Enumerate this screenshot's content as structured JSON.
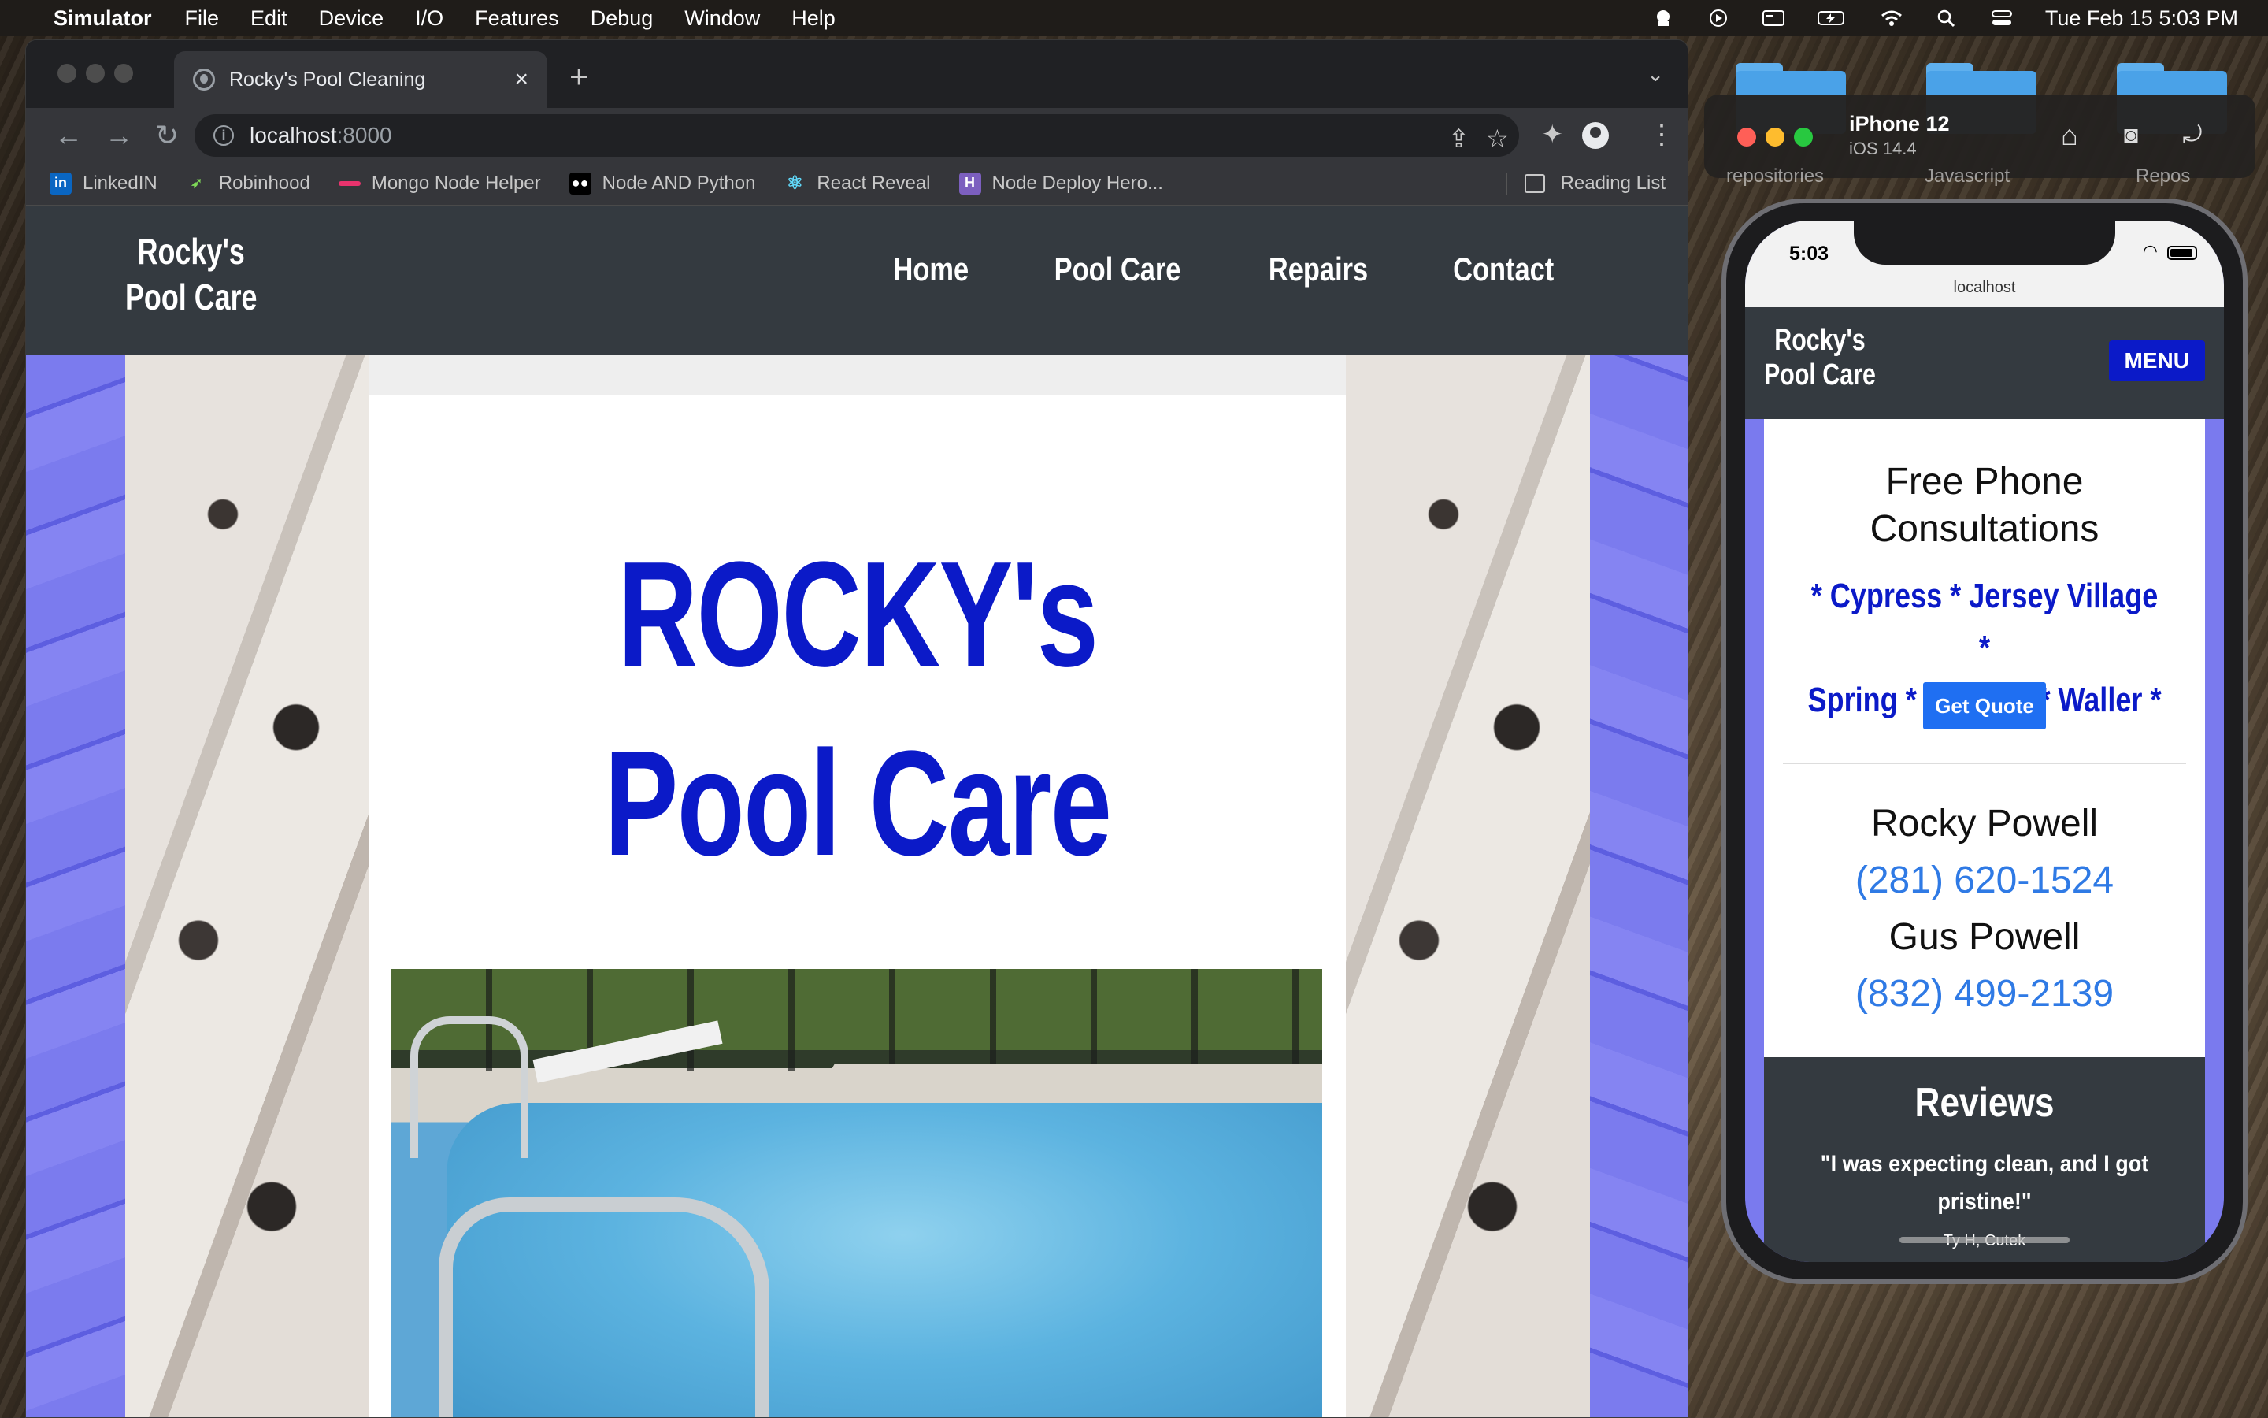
{
  "menubar": {
    "app_name": "Simulator",
    "items": [
      "File",
      "Edit",
      "Device",
      "I/O",
      "Features",
      "Debug",
      "Window",
      "Help"
    ],
    "datetime": "Tue Feb 15  5:03 PM"
  },
  "browser": {
    "tab_title": "Rocky's Pool Cleaning",
    "url_host": "localhost",
    "url_port": ":8000",
    "bookmarks": [
      "LinkedIN",
      "Robinhood",
      "Mongo Node Helper",
      "Node AND Python",
      "React Reveal",
      "Node Deploy Hero..."
    ],
    "reading_list": "Reading List"
  },
  "site": {
    "logo_line1": "Rocky's",
    "logo_line2": "Pool Care",
    "nav": [
      "Home",
      "Pool Care",
      "Repairs",
      "Contact"
    ],
    "hero_line1": "ROCKY's",
    "hero_line2": "Pool Care",
    "accent_color": "#0b1ac8"
  },
  "simulator": {
    "device": "iPhone 12",
    "os": "iOS 14.4",
    "ghost_labels": [
      "repositories",
      "Javascript",
      "Repos"
    ]
  },
  "phone": {
    "time": "5:03",
    "url": "localhost",
    "logo_line1": "Rocky's",
    "logo_line2": "Pool Care",
    "menu_button": "MENU",
    "free_line1": "Free Phone",
    "free_line2": "Consultations",
    "towns_line1": "* Cypress * Jersey Village *",
    "towns_line2": "Spring * Tomball * Waller *",
    "quote_button": "Get Quote",
    "contacts": [
      {
        "name": "Rocky Powell",
        "phone": "(281) 620-1524"
      },
      {
        "name": "Gus Powell",
        "phone": "(832) 499-2139"
      }
    ],
    "reviews_heading": "Reviews",
    "review_quote": "\"I was expecting clean, and I got pristine!\"",
    "review_author": "Ty H, Cutek"
  }
}
